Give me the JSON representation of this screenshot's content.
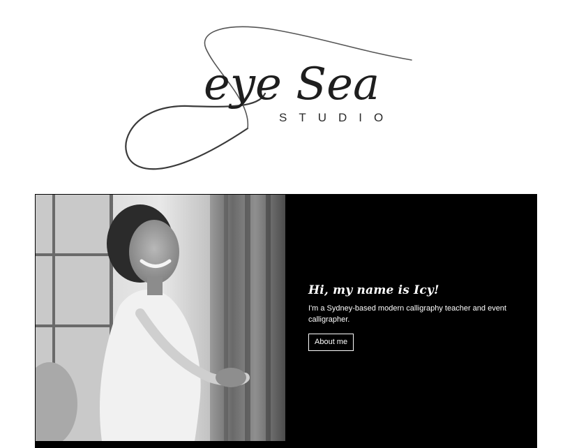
{
  "logo": {
    "script_text": "eye Sea",
    "sub_text": "STUDIO"
  },
  "hero": {
    "greeting": "Hi, my name is Icy!",
    "intro": "I'm a Sydney-based modern calligraphy teacher and event calligrapher.",
    "about_button_label": "About me",
    "photo_alt": "Smiling woman in white dress"
  },
  "colors": {
    "background": "#ffffff",
    "hero_background": "#000000",
    "text_light": "#ffffff",
    "logo_ink": "#222222"
  }
}
